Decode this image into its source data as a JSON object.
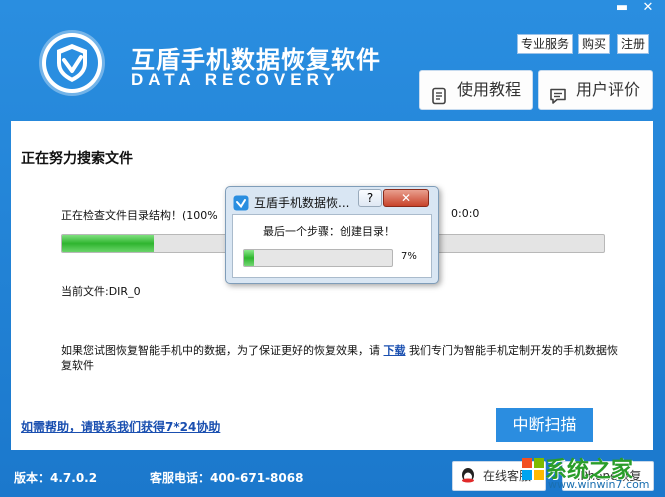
{
  "header": {
    "title": "互盾手机数据恢复软件",
    "subtitle": "DATA RECOVERY",
    "minimize_label": "▬",
    "close_label": "✕",
    "links": [
      {
        "label": "专业服务"
      },
      {
        "label": "购买"
      },
      {
        "label": "注册"
      }
    ],
    "tutorial_label": "使用教程",
    "review_label": "用户评价"
  },
  "main": {
    "status_title": "正在努力搜索文件",
    "check_text": "正在检查文件目录结构！(100%",
    "timer": "0:0:0",
    "progress": 0.17,
    "current_file": "当前文件:DIR_0",
    "info_before": "如果您试图恢复智能手机中的数据，为了保证更好的恢复效果，请",
    "info_link": "下载",
    "info_after": "我们专门为智能手机定制开发的手机数据恢复软件",
    "help_link": "如需帮助，请联系我们获得7*24协助",
    "stop_label": "中断扫描"
  },
  "footer": {
    "version": "版本：4.7.0.2",
    "phone": "客服电话：400-671-8068",
    "online_label": "在线客服",
    "iphone_label": "iPhone恢复",
    "watermark": "系统之家",
    "watermark_url": "www.winwin7.com"
  },
  "dialog": {
    "title": "互盾手机数据恢...",
    "help_label": "?",
    "close_label": "✕",
    "step": "最后一个步骤：创建目录！",
    "progress": 0.07,
    "percent": "7%"
  },
  "colors": {
    "accent": "#1b78cc",
    "button": "#2b8de0",
    "progress": "#2fb52f",
    "link": "#1a4fb0"
  }
}
